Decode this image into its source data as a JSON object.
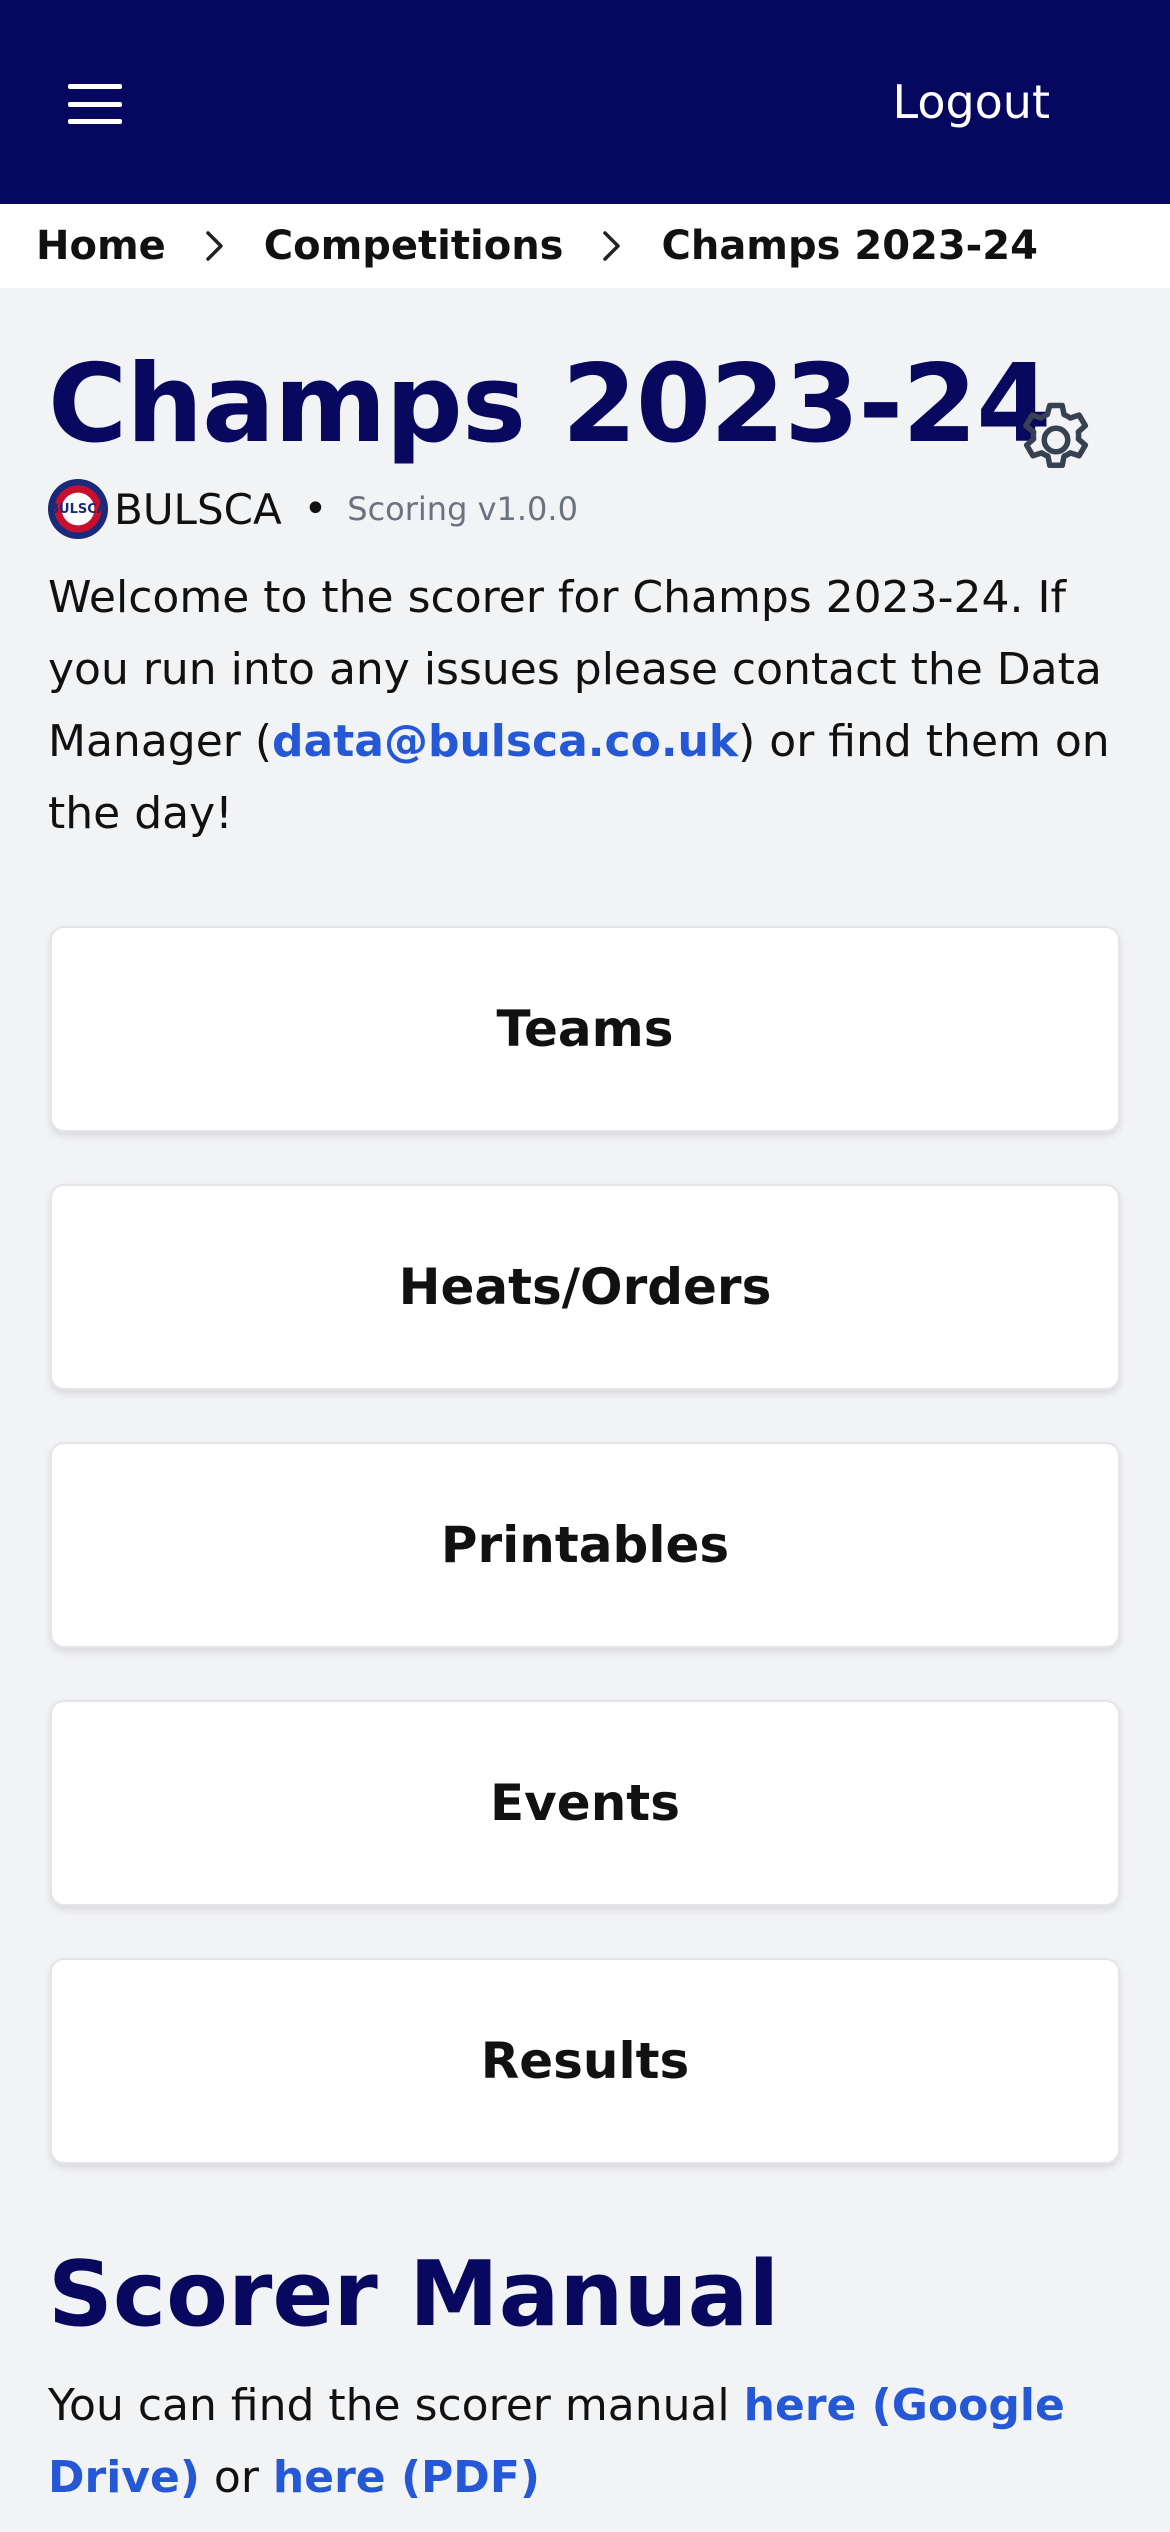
{
  "header": {
    "menu_icon": "hamburger-menu-icon",
    "logout_label": "Logout",
    "background_color": "#06075e"
  },
  "breadcrumb": {
    "items": [
      "Home",
      "Competitions",
      "Champs 2023-24"
    ],
    "separator_icon": "chevron-right-icon"
  },
  "page": {
    "title": "Champs 2023-24",
    "settings_icon": "gear-icon",
    "org_logo_text": "BULSCA",
    "org_name": "BULSCA",
    "version": "Scoring v1.0.0",
    "welcome_before": "Welcome to the scorer for Champs 2023-24. If you run into any issues please contact the Data Manager (",
    "welcome_email": "data@bulsca.co.uk",
    "welcome_after": ") or find them on the day!"
  },
  "nav_cards": [
    {
      "label": "Teams"
    },
    {
      "label": "Heats/Orders"
    },
    {
      "label": "Printables"
    },
    {
      "label": "Events"
    },
    {
      "label": "Results"
    }
  ],
  "manual": {
    "title": "Scorer Manual",
    "text_before": "You can find the scorer manual ",
    "link_drive": "here (Google Drive)",
    "text_middle": " or ",
    "link_pdf": "here (PDF)"
  },
  "colors": {
    "brand_navy": "#07085e",
    "link_blue": "#2458d6",
    "page_bg": "#f2f3f5"
  }
}
